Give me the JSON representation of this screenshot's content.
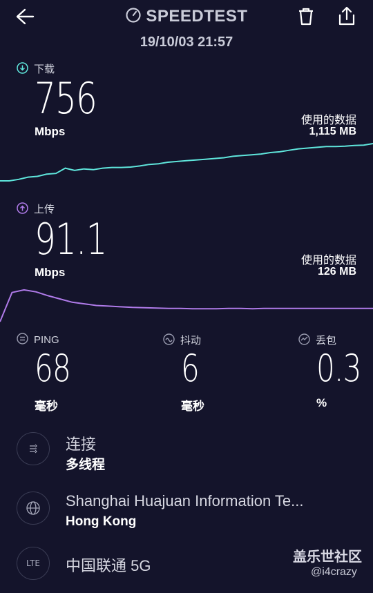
{
  "header": {
    "back_icon": "arrow-left-icon",
    "title": "SPEEDTEST",
    "date": "19/10/03 21:57",
    "trash_icon": "trash-icon",
    "share_icon": "share-icon"
  },
  "download": {
    "label": "下载",
    "value": "756",
    "unit": "Mbps",
    "data_label": "使用的数据",
    "data_value": "1,115 MB",
    "color": "#5fe6dc",
    "graph": [
      0.0,
      0.0,
      0.04,
      0.1,
      0.12,
      0.18,
      0.2,
      0.34,
      0.28,
      0.32,
      0.3,
      0.34,
      0.36,
      0.36,
      0.37,
      0.4,
      0.44,
      0.46,
      0.5,
      0.52,
      0.54,
      0.56,
      0.58,
      0.6,
      0.62,
      0.66,
      0.68,
      0.7,
      0.72,
      0.76,
      0.78,
      0.82,
      0.86,
      0.88,
      0.9,
      0.92,
      0.92,
      0.93,
      0.95,
      0.96,
      1.0
    ]
  },
  "upload": {
    "label": "上传",
    "value": "91.1",
    "unit": "Mbps",
    "data_label": "使用的数据",
    "data_value": "126 MB",
    "color": "#b07bea",
    "graph": [
      0.0,
      0.9,
      0.98,
      0.92,
      0.8,
      0.7,
      0.6,
      0.55,
      0.5,
      0.48,
      0.46,
      0.44,
      0.43,
      0.42,
      0.41,
      0.41,
      0.4,
      0.4,
      0.4,
      0.41,
      0.41,
      0.4,
      0.41,
      0.41,
      0.41,
      0.41,
      0.41,
      0.41,
      0.41,
      0.41,
      0.41,
      0.41
    ]
  },
  "stats": [
    {
      "icon": "ping-icon",
      "label": "PING",
      "value": "68",
      "unit": "毫秒"
    },
    {
      "icon": "jitter-icon",
      "label": "抖动",
      "value": "6",
      "unit": "毫秒"
    },
    {
      "icon": "packet-loss-icon",
      "label": "丢包",
      "value": "0.3",
      "unit": "%"
    }
  ],
  "connection": {
    "icon": "connections-icon",
    "title": "连接",
    "subtitle": "多线程"
  },
  "server": {
    "icon": "globe-icon",
    "title": "Shanghai Huajuan Information Te...",
    "subtitle": "Hong Kong"
  },
  "network": {
    "icon": "lte-icon",
    "icon_text": "LTE",
    "title": "中国联通 5G"
  },
  "watermark": {
    "line1": "盖乐世社区",
    "line2": "@i4crazy"
  }
}
